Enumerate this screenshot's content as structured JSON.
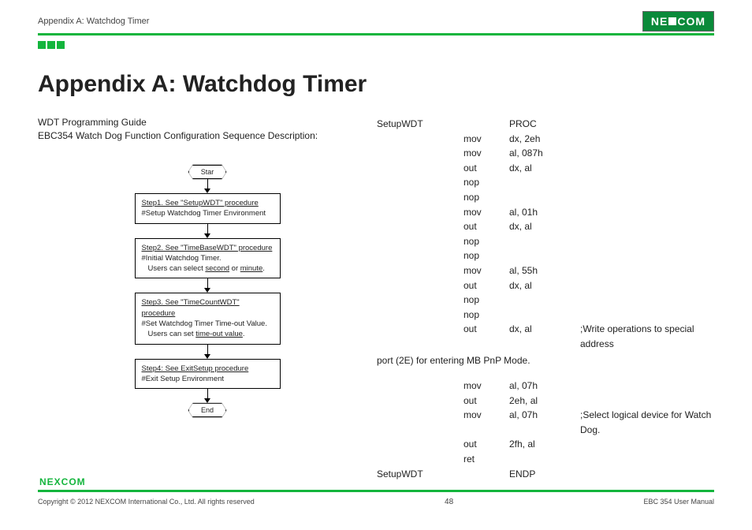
{
  "header": {
    "breadcrumb": "Appendix A: Watchdog Timer",
    "logo_text": "NE COM"
  },
  "title": "Appendix A: Watchdog Timer",
  "intro": {
    "line1": "WDT Programming Guide",
    "line2": "EBC354 Watch Dog Function Configuration Sequence Description:"
  },
  "flow": {
    "start": "Star",
    "step1_title": "Step1. See \"SetupWDT\" procedure",
    "step1_desc": "#Setup Watchdog Timer Environment",
    "step2_title": "Step2. See \"TimeBaseWDT\" procedure",
    "step2_desc1": "#Initial Watchdog Timer.",
    "step2_desc2a": "Users can select ",
    "step2_desc2b": "second",
    "step2_desc2c": " or ",
    "step2_desc2d": "minute",
    "step2_desc2e": ".",
    "step3_title": "Step3. See \"TimeCountWDT\" procedure",
    "step3_desc1": "#Set Watchdog Timer Time-out Value.",
    "step3_desc2a": "Users can set ",
    "step3_desc2b": "time-out value",
    "step3_desc2c": ".",
    "step4_title": "Step4: See ExitSetup procedure",
    "step4_desc": "#Exit Setup Environment",
    "end": "End"
  },
  "code": {
    "rows1": [
      [
        "SetupWDT",
        "",
        "PROC",
        ""
      ],
      [
        "",
        "mov",
        "dx, 2eh",
        ""
      ],
      [
        "",
        "mov",
        "al, 087h",
        ""
      ],
      [
        "",
        "out",
        "dx, al",
        ""
      ],
      [
        "",
        "nop",
        "",
        ""
      ],
      [
        "",
        "nop",
        "",
        ""
      ],
      [
        "",
        "mov",
        "al, 01h",
        ""
      ],
      [
        "",
        "out",
        "dx, al",
        ""
      ],
      [
        "",
        "nop",
        "",
        ""
      ],
      [
        "",
        "nop",
        "",
        ""
      ],
      [
        "",
        "mov",
        "al, 55h",
        ""
      ],
      [
        "",
        "out",
        "dx, al",
        ""
      ],
      [
        "",
        "nop",
        "",
        ""
      ],
      [
        "",
        "nop",
        "",
        ""
      ],
      [
        "",
        "out",
        "dx, al",
        ";Write operations to special address"
      ]
    ],
    "wrap_note": "port (2E) for entering MB PnP Mode.",
    "rows2": [
      [
        "",
        "mov",
        "al, 07h",
        ""
      ],
      [
        "",
        "out",
        "2eh, al",
        ""
      ],
      [
        "",
        "mov",
        "al, 07h",
        ";Select logical device for Watch Dog."
      ],
      [
        "",
        "out",
        "2fh, al",
        ""
      ],
      [
        "",
        "ret",
        "",
        ""
      ],
      [
        "SetupWDT",
        "",
        "ENDP",
        ""
      ]
    ]
  },
  "footer": {
    "logo": "NEXCOM",
    "copyright": "Copyright © 2012 NEXCOM International Co., Ltd. All rights reserved",
    "page": "48",
    "manual": "EBC 354 User Manual"
  }
}
